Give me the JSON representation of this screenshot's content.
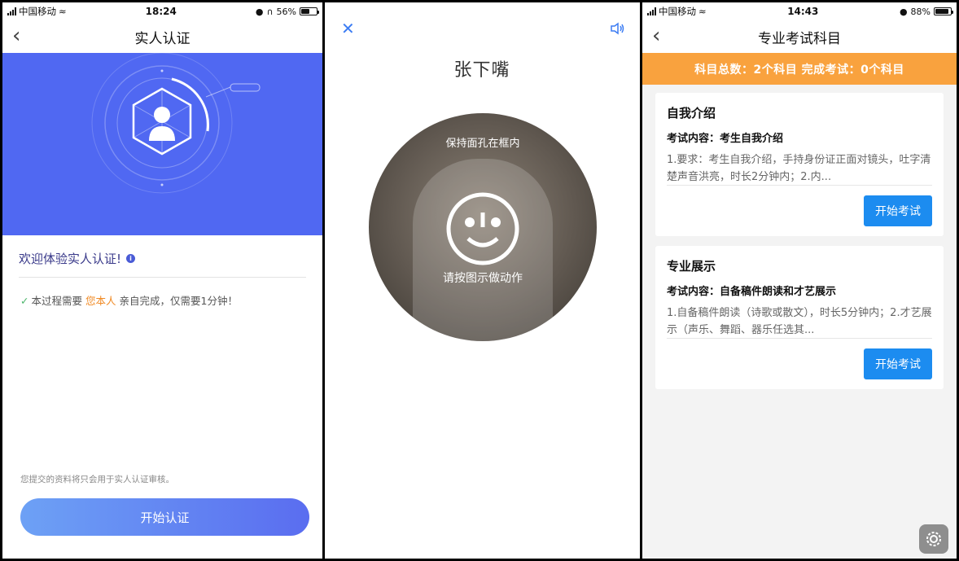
{
  "panel1": {
    "status": {
      "carrier": "中国移动",
      "time": "18:24",
      "battery": "56%"
    },
    "nav_title": "实人认证",
    "welcome": "欢迎体验实人认证!",
    "notice_pre": "本过程需要",
    "notice_highlight": "您本人",
    "notice_post": "亲自完成，仅需要1分钟！",
    "privacy": "您提交的资料将只会用于实人认证审核。",
    "start_button": "开始认证",
    "colors": {
      "hero": "#5068f2",
      "button_start": "#6da1f5",
      "button_end": "#5a6df0",
      "highlight": "#f08a24"
    }
  },
  "panel2": {
    "title": "张下嘴",
    "hint_top": "保持面孔在框内",
    "hint_bottom": "请按图示做动作",
    "icons": {
      "close": "close-icon",
      "speaker": "speaker-icon",
      "face": "smile-face-icon"
    }
  },
  "panel3": {
    "status": {
      "carrier": "中国移动",
      "time": "14:43",
      "battery": "88%"
    },
    "nav_title": "专业考试科目",
    "summary": "科目总数：2个科目  完成考试：0个科目",
    "cards": [
      {
        "title": "自我介绍",
        "content": "考试内容：考生自我介绍",
        "desc": "1.要求：考生自我介绍，手持身份证正面对镜头，吐字清楚声音洪亮，时长2分钟内；2.内...",
        "button": "开始考试"
      },
      {
        "title": "专业展示",
        "content": "考试内容：自备稿件朗读和才艺展示",
        "desc": "1.自备稿件朗读（诗歌或散文），时长5分钟内；2.才艺展示（声乐、舞蹈、器乐任选其...",
        "button": "开始考试"
      }
    ],
    "colors": {
      "summary_bar": "#f9a23e",
      "button": "#1c8cf0"
    }
  }
}
